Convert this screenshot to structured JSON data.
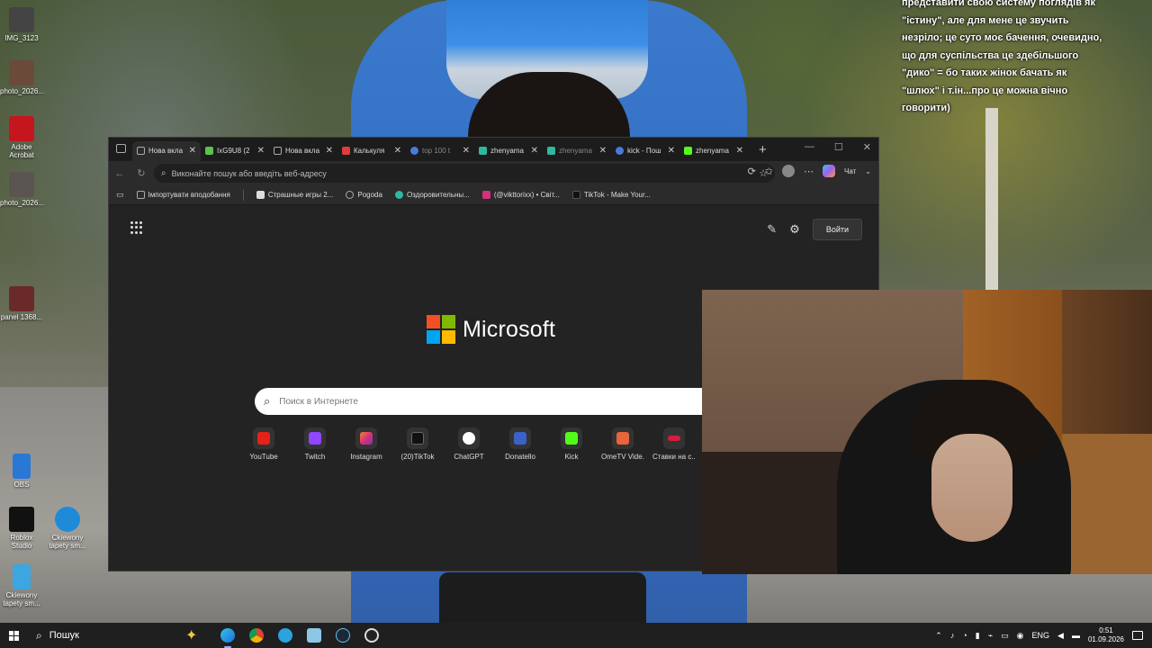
{
  "overlay": {
    "lines": [
      "представити свою систему поглядів як",
      "\"істину\", але для мене це звучить",
      "незріло; це суто моє бачення, очевидно,",
      "що для суспільства це здебільшого",
      "\"дико\" = бо таких жінок бачать як",
      "\"шлюх\" і т.ін...про це можна вічно",
      "говорити)"
    ]
  },
  "desktop_icons": [
    {
      "label": "IMG_3123",
      "icon": "image-icon",
      "color": "#444"
    },
    {
      "label": "photo_2026...",
      "icon": "image-icon",
      "color": "#6b4a3a"
    },
    {
      "label": "Adobe Acrobat",
      "icon": "acrobat-icon",
      "color": "#c4161c"
    },
    {
      "label": "photo_2026...",
      "icon": "image-icon",
      "color": "#5a5550"
    },
    {
      "label": "panel 1368...",
      "icon": "image-icon",
      "color": "#6a2a2a"
    },
    {
      "label": "OBS",
      "icon": "document-icon",
      "color": "#2a78d6"
    },
    {
      "label": "Roblox Studio",
      "icon": "roblox-icon",
      "color": "#111"
    },
    {
      "label": "Сkiewony tapety sm...",
      "icon": "edge-icon",
      "color": "#1e8bd8"
    },
    {
      "label": "Сkiewony tapety sm...",
      "icon": "document-icon",
      "color": "#3ca6e0"
    }
  ],
  "browser": {
    "tabs": [
      {
        "label": "Нова вкла",
        "color": "#888",
        "active": true
      },
      {
        "label": "IxG9U8 (2",
        "color": "#5ec14c",
        "active": false
      },
      {
        "label": "Нова вкла",
        "color": "#888",
        "active": false
      },
      {
        "label": "Калькуля",
        "color": "#e03c3c",
        "active": false
      },
      {
        "label": "top 100 t",
        "color": "#4a7bd8",
        "active": false,
        "dim": true
      },
      {
        "label": "zhenyama",
        "color": "#2fb8a0",
        "active": false
      },
      {
        "label": "zhenyama",
        "color": "#2fb8a0",
        "active": false,
        "dim": true
      },
      {
        "label": "kick - Пош",
        "color": "#4a7bd8",
        "active": false
      },
      {
        "label": "zhenyama",
        "color": "#53fc18",
        "active": false
      }
    ],
    "new_tab": "+",
    "controls": {
      "minimize": "—",
      "maximize": "☐",
      "close": "✕"
    },
    "address_placeholder": "Виконайте пошук або введіть веб-адресу",
    "chat_label": "Чат",
    "bookmarks": [
      {
        "label": "Імпортувати вподобання",
        "color": "#888"
      },
      {
        "label": "Страшные игры 2...",
        "color": "#ddd"
      },
      {
        "label": "Pogoda",
        "color": "#888"
      },
      {
        "label": "Оздоровительны...",
        "color": "#2fb8a0"
      },
      {
        "label": "(@vikttorixx) • Світ...",
        "color": "#d6317b"
      },
      {
        "label": "TikTok - Make Your...",
        "color": "#111"
      }
    ],
    "signin_label": "Войти",
    "brand": "Microsoft",
    "search_placeholder": "Поиск в Интернете",
    "quick_links": [
      {
        "label": "YouTube",
        "icon": "youtube-icon",
        "color": "#e62117"
      },
      {
        "label": "Twitch",
        "icon": "twitch-icon",
        "color": "#9146ff"
      },
      {
        "label": "Instagram",
        "icon": "instagram-icon",
        "color": "#d6317b"
      },
      {
        "label": "(20)TikTok",
        "icon": "tiktok-icon",
        "color": "#111"
      },
      {
        "label": "ChatGPT",
        "icon": "chatgpt-icon",
        "color": "#ffffff"
      },
      {
        "label": "Donatello",
        "icon": "donatello-icon",
        "color": "#3a62c8"
      },
      {
        "label": "Kick",
        "icon": "kick-icon",
        "color": "#53fc18"
      },
      {
        "label": "OmeTV Vide...",
        "icon": "ometv-icon",
        "color": "#e8643c"
      },
      {
        "label": "Ставки на с...",
        "icon": "bet-icon",
        "color": "#d21f3c"
      }
    ]
  },
  "taskbar": {
    "search_label": "Пошук",
    "language": "ENG",
    "time": "0:51",
    "date": "01.09.2026"
  }
}
